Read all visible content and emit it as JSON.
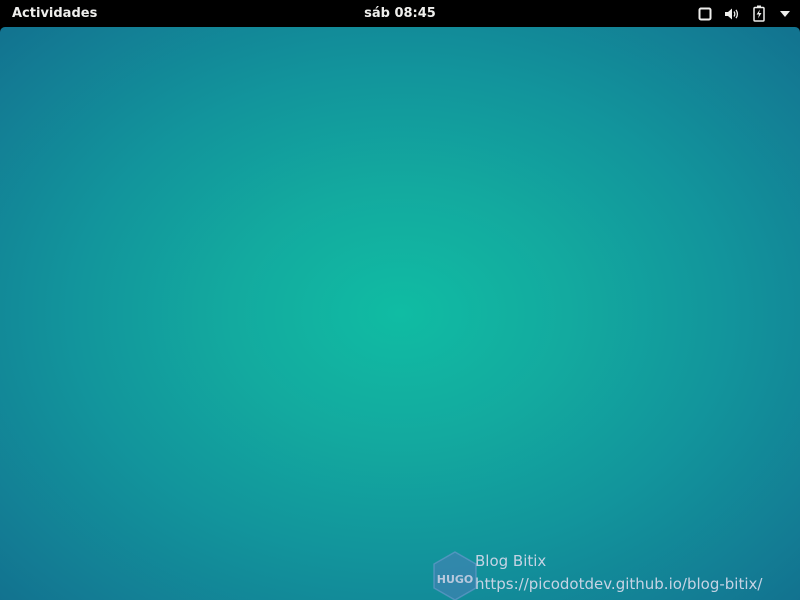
{
  "topbar": {
    "activities_label": "Actividades",
    "clock": "sáb 08:45",
    "indicators": [
      {
        "icon": "window-icon"
      },
      {
        "icon": "volume-icon"
      },
      {
        "icon": "battery-charging-icon"
      },
      {
        "icon": "chevron-down-icon"
      }
    ]
  },
  "desktop": {
    "background_colors": {
      "center": "#10bca3",
      "edge": "#12728f"
    }
  },
  "watermark": {
    "logo_text": "HUGO",
    "title": "Blog Bitix",
    "url": "https://picodotdev.github.io/blog-bitix/"
  },
  "colors": {
    "topbar_bg": "#000000",
    "topbar_text": "#eeeeec"
  }
}
